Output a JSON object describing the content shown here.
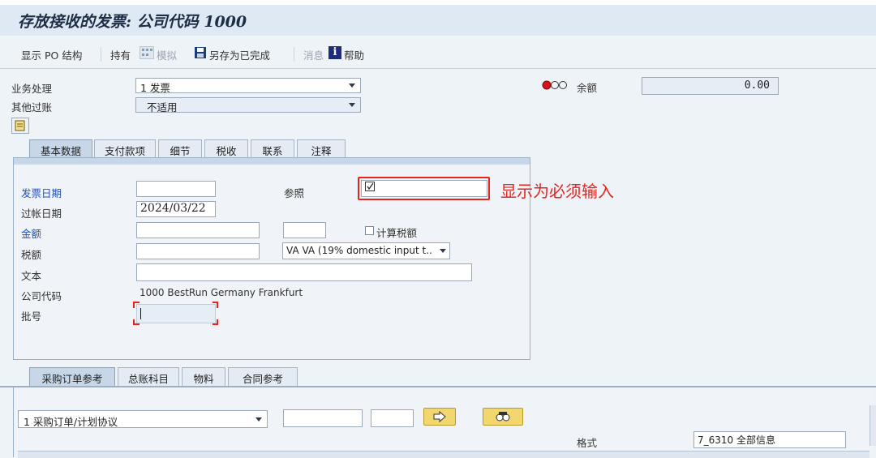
{
  "header": {
    "title": "存放接收的发票: 公司代码 1000"
  },
  "toolbar": {
    "show_po_structure": "显示 PO 结构",
    "hold": "持有",
    "simulate": "模拟",
    "save_as_completed": "另存为已完成",
    "messages": "消息",
    "help": "帮助"
  },
  "top": {
    "transaction_label": "业务处理",
    "transaction_value": "1 发票",
    "other_posting_label": "其他过账",
    "other_posting_value": "不适用",
    "balance_label": "余额",
    "balance_value": "0.00"
  },
  "tabs": [
    {
      "label": "基本数据",
      "active": true
    },
    {
      "label": "支付款项"
    },
    {
      "label": "细节"
    },
    {
      "label": "税收"
    },
    {
      "label": "联系"
    },
    {
      "label": "注释"
    }
  ],
  "basic": {
    "invoice_date_label": "发票日期",
    "invoice_date_value": "",
    "reference_label": "参照",
    "posting_date_label": "过帐日期",
    "posting_date_value": "2024/03/22",
    "amount_label": "金额",
    "calc_tax_label": "计算税额",
    "tax_amount_label": "税额",
    "tax_code_value": "VA VA (19% domestic input t..",
    "text_label": "文本",
    "company_code_label": "公司代码",
    "company_code_value": "1000 BestRun Germany Frankfurt",
    "batch_label": "批号"
  },
  "annotation": {
    "text": "显示为必须输入",
    "color": "#e8241f"
  },
  "lower_tabs": [
    {
      "label": "采购订单参考",
      "active": true
    },
    {
      "label": "总账科目"
    },
    {
      "label": "物料"
    },
    {
      "label": "合同参考"
    }
  ],
  "lower": {
    "po_type_value": "1 采购订单/计划协议",
    "layout_label": "格式",
    "layout_value": "7_6310 全部信息"
  },
  "colors": {
    "accent_blue": "#2250b8",
    "status_red": "#d6121a",
    "button_yellow": "#f2d66e"
  }
}
